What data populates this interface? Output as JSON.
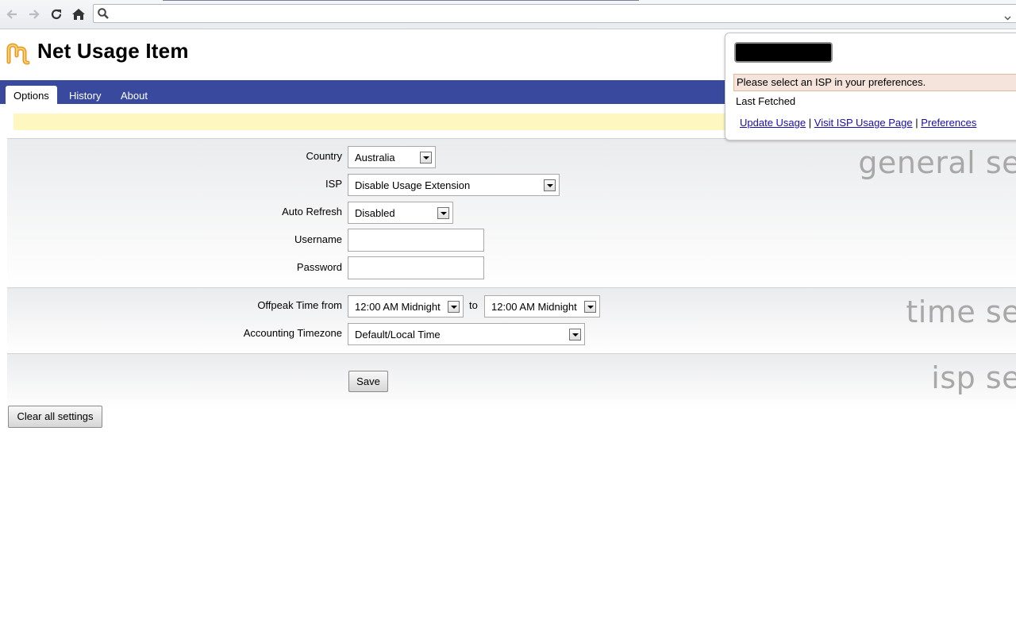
{
  "browser": {
    "address_value": ""
  },
  "header": {
    "title": "Net Usage Item"
  },
  "tabs": [
    {
      "label": "Options",
      "active": true
    },
    {
      "label": "History",
      "active": false
    },
    {
      "label": "About",
      "active": false
    }
  ],
  "general": {
    "section_title": "general se",
    "country_label": "Country",
    "country_value": "Australia",
    "isp_label": "ISP",
    "isp_value": "Disable Usage Extension",
    "auto_refresh_label": "Auto Refresh",
    "auto_refresh_value": "Disabled",
    "username_label": "Username",
    "username_value": "",
    "password_label": "Password",
    "password_value": ""
  },
  "time": {
    "section_title": "time se",
    "offpeak_label": "Offpeak Time from",
    "offpeak_from_value": "12:00 AM Midnight",
    "to_label": "to",
    "offpeak_to_value": "12:00 AM Midnight",
    "timezone_label": "Accounting Timezone",
    "timezone_value": "Default/Local Time"
  },
  "isp": {
    "section_title": "isp se"
  },
  "actions": {
    "save_label": "Save",
    "clear_label": "Clear all settings"
  },
  "popup": {
    "error_text": "Please select an ISP in your preferences.",
    "last_fetched_label": "Last Fetched",
    "links": {
      "update_usage": "Update Usage",
      "visit_isp": "Visit ISP Usage Page",
      "preferences": "Preferences",
      "separator": "|"
    }
  },
  "colors": {
    "tabbar": "#394a9e",
    "notice_bg": "#fff7c0",
    "error_bg": "#f5e4dc",
    "link": "#1a0dab"
  },
  "icons": {
    "back": "back-arrow-icon",
    "forward": "forward-arrow-icon",
    "reload": "reload-icon",
    "home": "home-icon",
    "search": "search-icon",
    "logo": "app-logo"
  }
}
